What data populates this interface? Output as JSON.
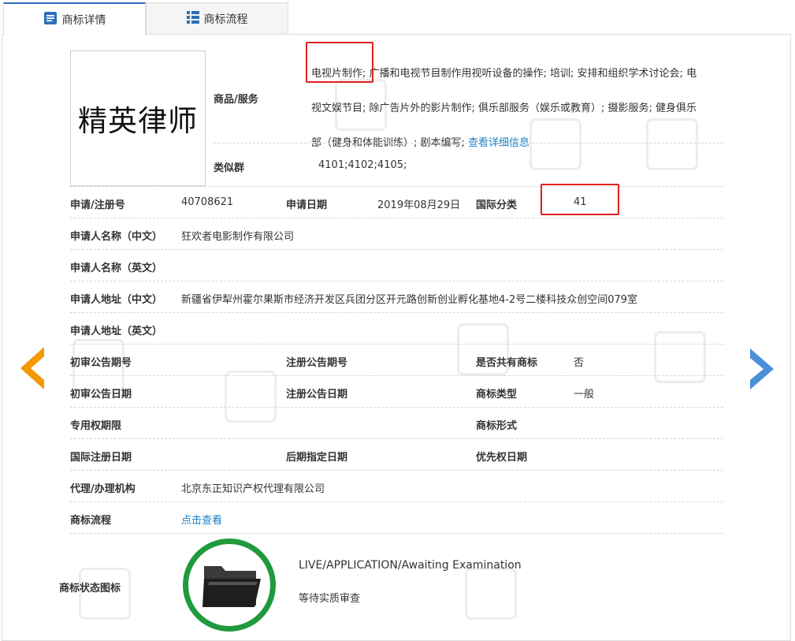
{
  "tabs": [
    {
      "label": "商标详情",
      "active": true,
      "icon": "document-icon"
    },
    {
      "label": "商标流程",
      "active": false,
      "icon": "list-icon"
    }
  ],
  "logo_text": "精英律师",
  "goods": {
    "label": "商品/服务",
    "line1_highlight": "电视片制作",
    "line1_rest": "; 广播和电视节目制作用视听设备的操作; 培训; 安排和组织学术讨论会; 电",
    "line2": "视文娱节目; 除广告片外的影片制作; 俱乐部服务（娱乐或教育）; 摄影服务; 健身俱乐",
    "line3": "部（健身和体能训练）; 剧本编写; ",
    "detail_link": "查看详细信息"
  },
  "similar_group": {
    "label": "类似群",
    "value": "4101;4102;4105;"
  },
  "reg_no": {
    "label": "申请/注册号",
    "value": "40708621"
  },
  "app_date": {
    "label": "申请日期",
    "value": "2019年08月29日"
  },
  "intl_class": {
    "label": "国际分类",
    "value": "41"
  },
  "applicant_cn": {
    "label": "申请人名称（中文）",
    "value": "狂欢者电影制作有限公司"
  },
  "applicant_en": {
    "label": "申请人名称（英文）",
    "value": ""
  },
  "address_cn": {
    "label": "申请人地址（中文）",
    "value": "新疆省伊犁州霍尔果斯市经济开发区兵团分区开元路创新创业孵化基地4-2号二楼科技众创空间079室"
  },
  "address_en": {
    "label": "申请人地址（英文）",
    "value": ""
  },
  "prelim_no": {
    "label": "初审公告期号",
    "value": ""
  },
  "reg_pub_no": {
    "label": "注册公告期号",
    "value": ""
  },
  "shared": {
    "label": "是否共有商标",
    "value": "否"
  },
  "prelim_date": {
    "label": "初审公告日期",
    "value": ""
  },
  "reg_pub_date": {
    "label": "注册公告日期",
    "value": ""
  },
  "tm_type": {
    "label": "商标类型",
    "value": "一般"
  },
  "exclusive_period": {
    "label": "专用权期限",
    "value": ""
  },
  "tm_form": {
    "label": "商标形式",
    "value": ""
  },
  "intl_reg_date": {
    "label": "国际注册日期",
    "value": ""
  },
  "later_designation": {
    "label": "后期指定日期",
    "value": ""
  },
  "priority_date": {
    "label": "优先权日期",
    "value": ""
  },
  "agent": {
    "label": "代理/办理机构",
    "value": "北京东正知识产权代理有限公司"
  },
  "flow": {
    "label": "商标流程",
    "link": "点击查看"
  },
  "status": {
    "label": "商标状态图标",
    "en": "LIVE/APPLICATION/Awaiting Examination",
    "cn": "等待实质审查",
    "icon": "folder-icon"
  },
  "colors": {
    "accent_blue": "#1a7fc6",
    "highlight_red": "#e02020",
    "status_green": "#1f9a3c",
    "arrow_orange": "#f39800",
    "arrow_blue": "#4a90d9"
  }
}
